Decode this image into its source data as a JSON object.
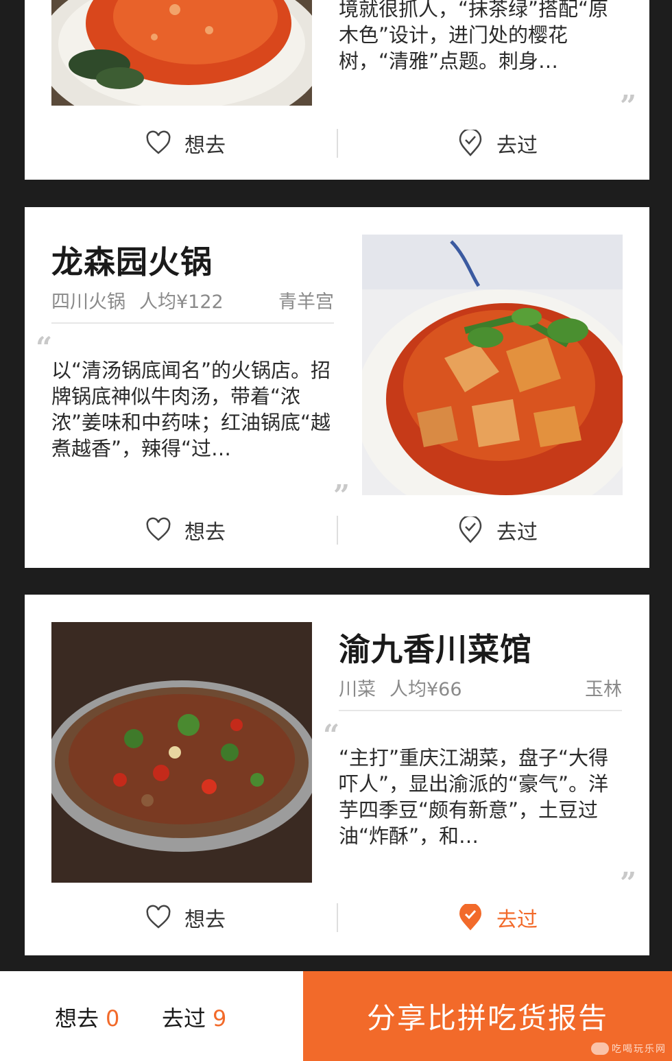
{
  "cards": [
    {
      "description_tail": "境就很抓人，“抹茶绿”搭配“原木色”设计，进门处的樱花树，“清雅”点题。刺身…",
      "actions": {
        "want_label": "想去",
        "been_label": "去过"
      }
    },
    {
      "name": "龙森园火锅",
      "cuisine": "四川火锅",
      "price": "人均¥122",
      "area": "青羊宫",
      "description": "以“清汤锅底闻名”的火锅店。招牌锅底神似牛肉汤，带着“浓浓”姜味和中药味；红油锅底“越煮越香”，辣得“过…",
      "actions": {
        "want_label": "想去",
        "been_label": "去过"
      }
    },
    {
      "name": "渝九香川菜馆",
      "cuisine": "川菜",
      "price": "人均¥66",
      "area": "玉林",
      "description": "“主打”重庆江湖菜，盘子“大得吓人”，显出渝派的“豪气”。洋芋四季豆“颇有新意”，土豆过油“炸酥”，和…",
      "actions": {
        "want_label": "想去",
        "been_label": "去过"
      }
    }
  ],
  "quote_open": "“",
  "quote_close": "”",
  "bottom_bar": {
    "want_label": "想去",
    "want_count": "0",
    "been_label": "去过",
    "been_count": "9",
    "share_label": "分享比拼吃货报告",
    "watermark": "吃喝玩乐网"
  },
  "colors": {
    "accent": "#f26a2a",
    "background": "#1d1d1d",
    "card": "#ffffff"
  }
}
